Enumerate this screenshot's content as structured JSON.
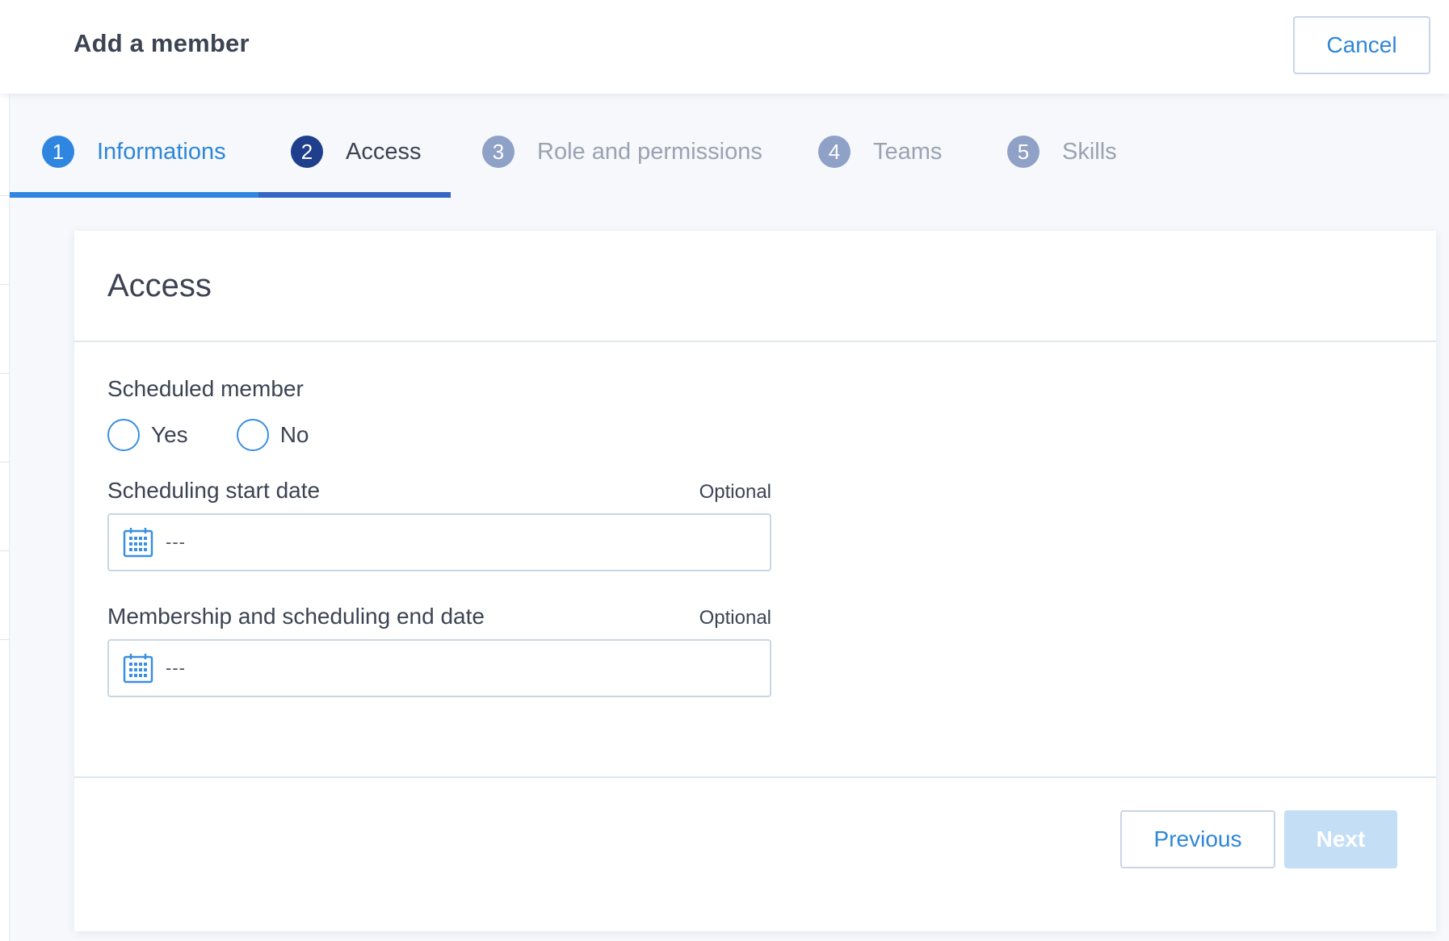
{
  "header": {
    "title": "Add a member",
    "cancel_label": "Cancel"
  },
  "stepper": {
    "steps": [
      {
        "number": "1",
        "label": "Informations",
        "state": "done"
      },
      {
        "number": "2",
        "label": "Access",
        "state": "current"
      },
      {
        "number": "3",
        "label": "Role and permissions",
        "state": "pending"
      },
      {
        "number": "4",
        "label": "Teams",
        "state": "pending"
      },
      {
        "number": "5",
        "label": "Skills",
        "state": "pending"
      }
    ]
  },
  "form": {
    "title": "Access",
    "scheduled_member": {
      "label": "Scheduled member",
      "options": [
        {
          "label": "Yes",
          "selected": false
        },
        {
          "label": "No",
          "selected": false
        }
      ]
    },
    "start_date": {
      "label": "Scheduling start date",
      "optional_label": "Optional",
      "value": "---",
      "icon": "calendar-icon"
    },
    "end_date": {
      "label": "Membership and scheduling end date",
      "optional_label": "Optional",
      "value": "---",
      "icon": "calendar-icon"
    },
    "previous_label": "Previous",
    "next_label": "Next"
  },
  "colors": {
    "accent": "#2f86d8",
    "step_done": "#2f86e0",
    "step_current": "#1f3f8c",
    "step_pending": "#8fa1c7",
    "next_disabled": "#c4def6"
  }
}
